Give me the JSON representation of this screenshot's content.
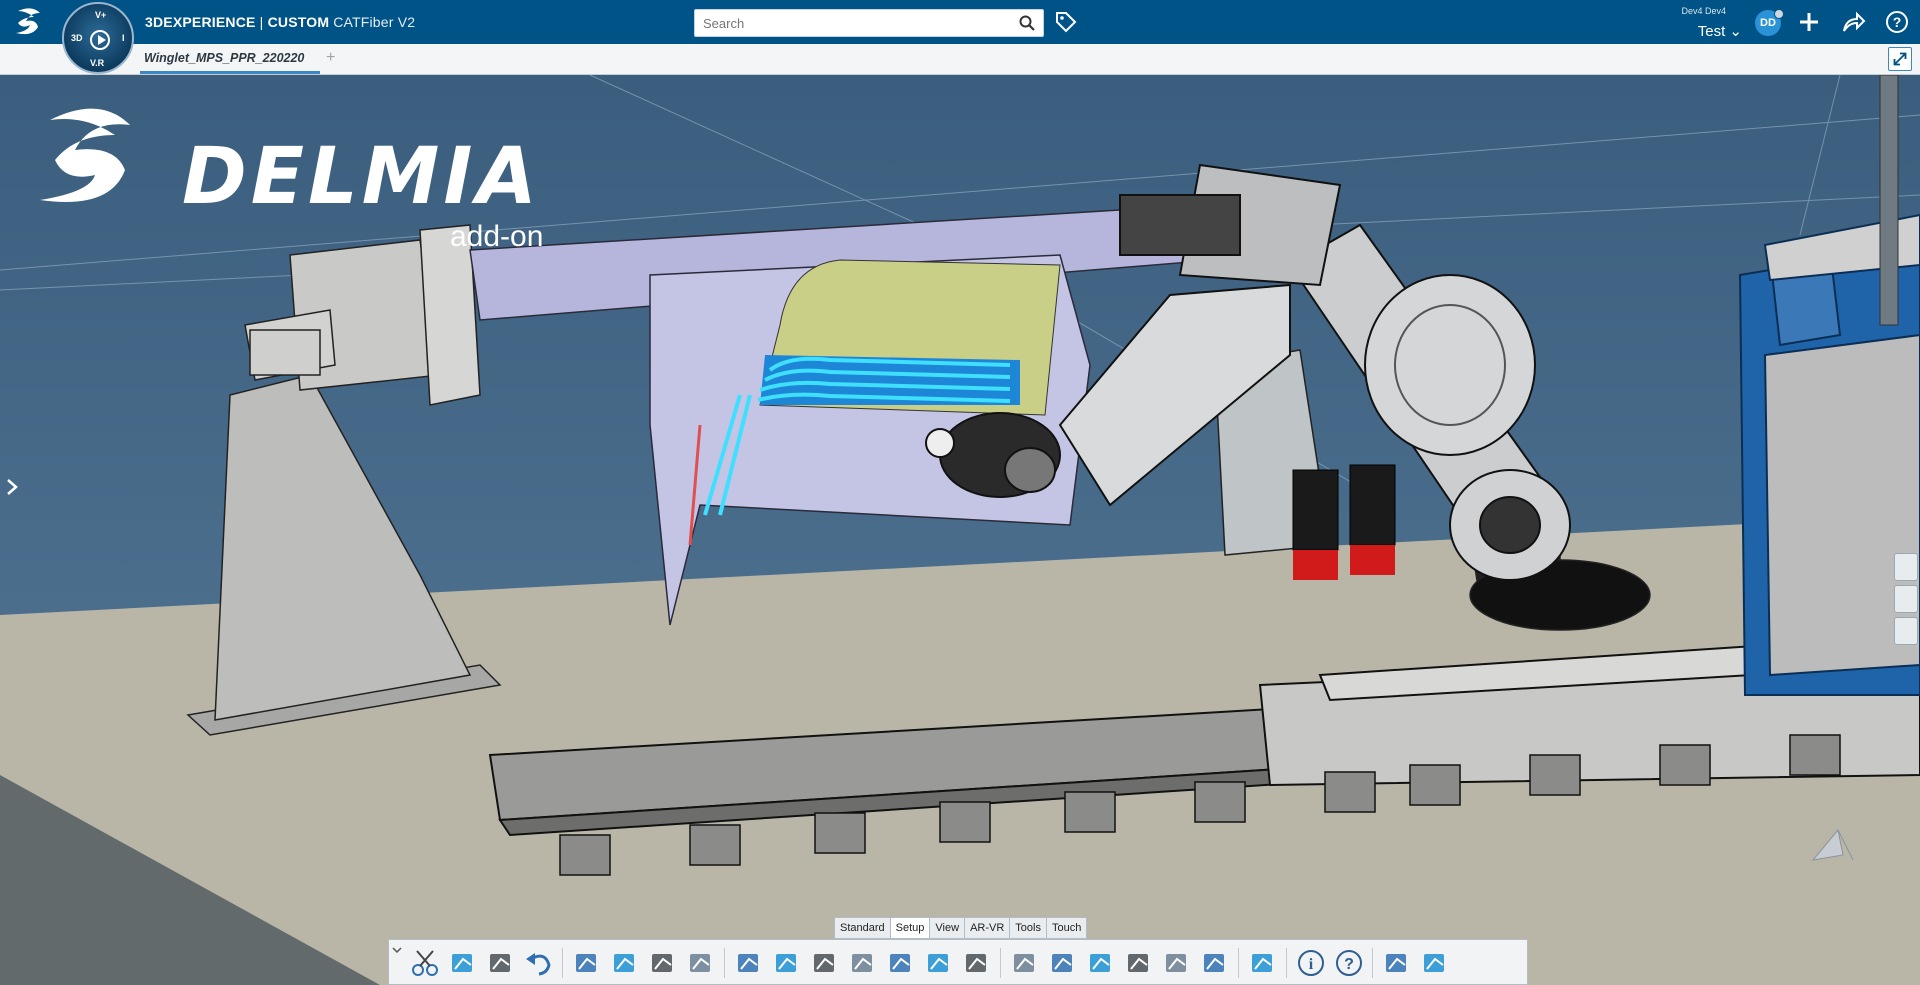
{
  "topbar": {
    "brand_main": "3DEXPERIENCE",
    "brand_sep": " | ",
    "brand_custom": "CUSTOM",
    "brand_app": "CATFiber V2",
    "compass_letters": {
      "top": "V+",
      "left": "3D",
      "right": "I",
      "bottom": "V.R"
    },
    "search_placeholder": "Search",
    "user_small": "Dev4 Dev4",
    "collab_space": "Test",
    "avatar_initials": "DD",
    "icons": [
      "ds-logo-icon",
      "compass-icon",
      "search-icon",
      "tag-icon",
      "add-icon",
      "share-icon",
      "help-icon"
    ]
  },
  "tabbar": {
    "active_tab": "Winglet_MPS_PPR_220220",
    "add_tab": "+"
  },
  "viewport": {
    "logo_word": "DELMIA",
    "logo_sub": "add-on",
    "side_tools": [
      "flag-icon",
      "camera-icon",
      "view-icon"
    ]
  },
  "action_bar": {
    "sections": [
      "Standard",
      "Setup",
      "View",
      "AR-VR",
      "Tools",
      "Touch"
    ],
    "active_section": "Setup",
    "tools": [
      "cut-icon",
      "copy-icon",
      "paste-icon",
      "undo-icon",
      "robot-teach-icon",
      "trajectory-icon",
      "check-reach-icon",
      "layup-grid-icon",
      "program-icon",
      "sequence-icon",
      "operations-icon",
      "tool-path-icon",
      "fiber-placement-icon",
      "course-icon",
      "cad-fiber-icon",
      "export-icon",
      "measure-icon",
      "ply-angle-icon",
      "laminate-icon",
      "cure-icon",
      "heat-map-icon",
      "panels-icon",
      "info-icon",
      "help-icon",
      "swap-icon",
      "device-icon"
    ]
  },
  "colors": {
    "topbar": "#005386",
    "accent": "#3b86c6",
    "viewport_bg": "#3d5f7d",
    "tool_path_cyan": "#1ec8ff",
    "fixture_purple": "#b9b9de",
    "robot_blue_base": "#1f64a8",
    "red_accent": "#d11a1a"
  }
}
